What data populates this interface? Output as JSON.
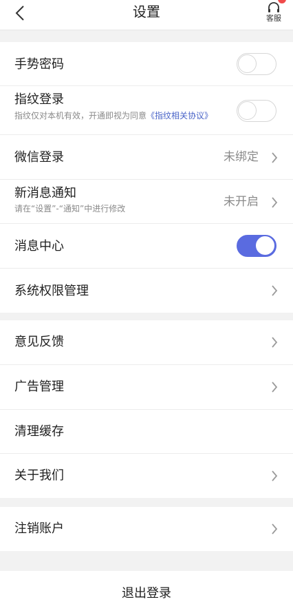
{
  "header": {
    "title": "设置",
    "service_label": "客服"
  },
  "security": {
    "gesture_label": "手势密码",
    "fingerprint_label": "指纹登录",
    "fingerprint_sub": "指纹仅对本机有效，开通即视为同意",
    "fingerprint_link": "《指纹相关协议》",
    "wechat_label": "微信登录",
    "wechat_status": "未绑定",
    "notify_label": "新消息通知",
    "notify_sub": "请在“设置”-“通知”中进行修改",
    "notify_status": "未开启",
    "center_label": "消息中心",
    "permission_label": "系统权限管理"
  },
  "general": {
    "feedback_label": "意见反馈",
    "ads_label": "广告管理",
    "cache_label": "清理缓存",
    "about_label": "关于我们"
  },
  "account": {
    "cancel_label": "注销账户"
  },
  "logout": {
    "label": "退出登录"
  },
  "toggles": {
    "gesture": false,
    "fingerprint": false,
    "message_center": true
  },
  "colors": {
    "accent": "#5a6be0",
    "link": "#4a64c8",
    "badge": "#f04a4a"
  }
}
